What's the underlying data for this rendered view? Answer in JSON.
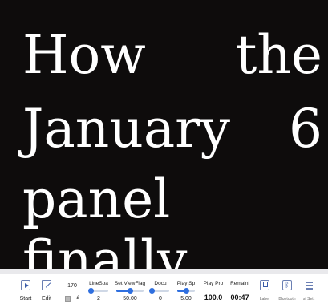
{
  "script": {
    "line1": [
      "How",
      "the"
    ],
    "line2": [
      "January",
      "6"
    ],
    "line3": "panel",
    "line4": "finally"
  },
  "toolbar": {
    "start": {
      "label": "Start"
    },
    "edit": {
      "label": "Edit"
    },
    "font_size": {
      "value": "170",
      "font_label": "£"
    },
    "line_spacing": {
      "label": "LineSpa",
      "value": "2",
      "level": 0.1
    },
    "set_view_flag": {
      "label": "Set ViewFlag",
      "value": "50.00",
      "level": 0.5
    },
    "document": {
      "label": "Docu",
      "value": "0",
      "level": 0.0
    },
    "play_speed": {
      "label": "Play Sp",
      "value": "5.00",
      "level": 0.5
    },
    "play_progress": {
      "label": "Play Pro",
      "value": "100.0"
    },
    "remaining": {
      "label": "Remaini",
      "value": "00:47"
    },
    "label_btn": {
      "label": "Label"
    },
    "bluetooth_btn": {
      "label": "Bluetooth"
    },
    "list_btn": {
      "label": "st Sett"
    }
  },
  "colors": {
    "accent": "#2f6fdf",
    "background": "#0e0c0c",
    "text": "#ffffff"
  }
}
